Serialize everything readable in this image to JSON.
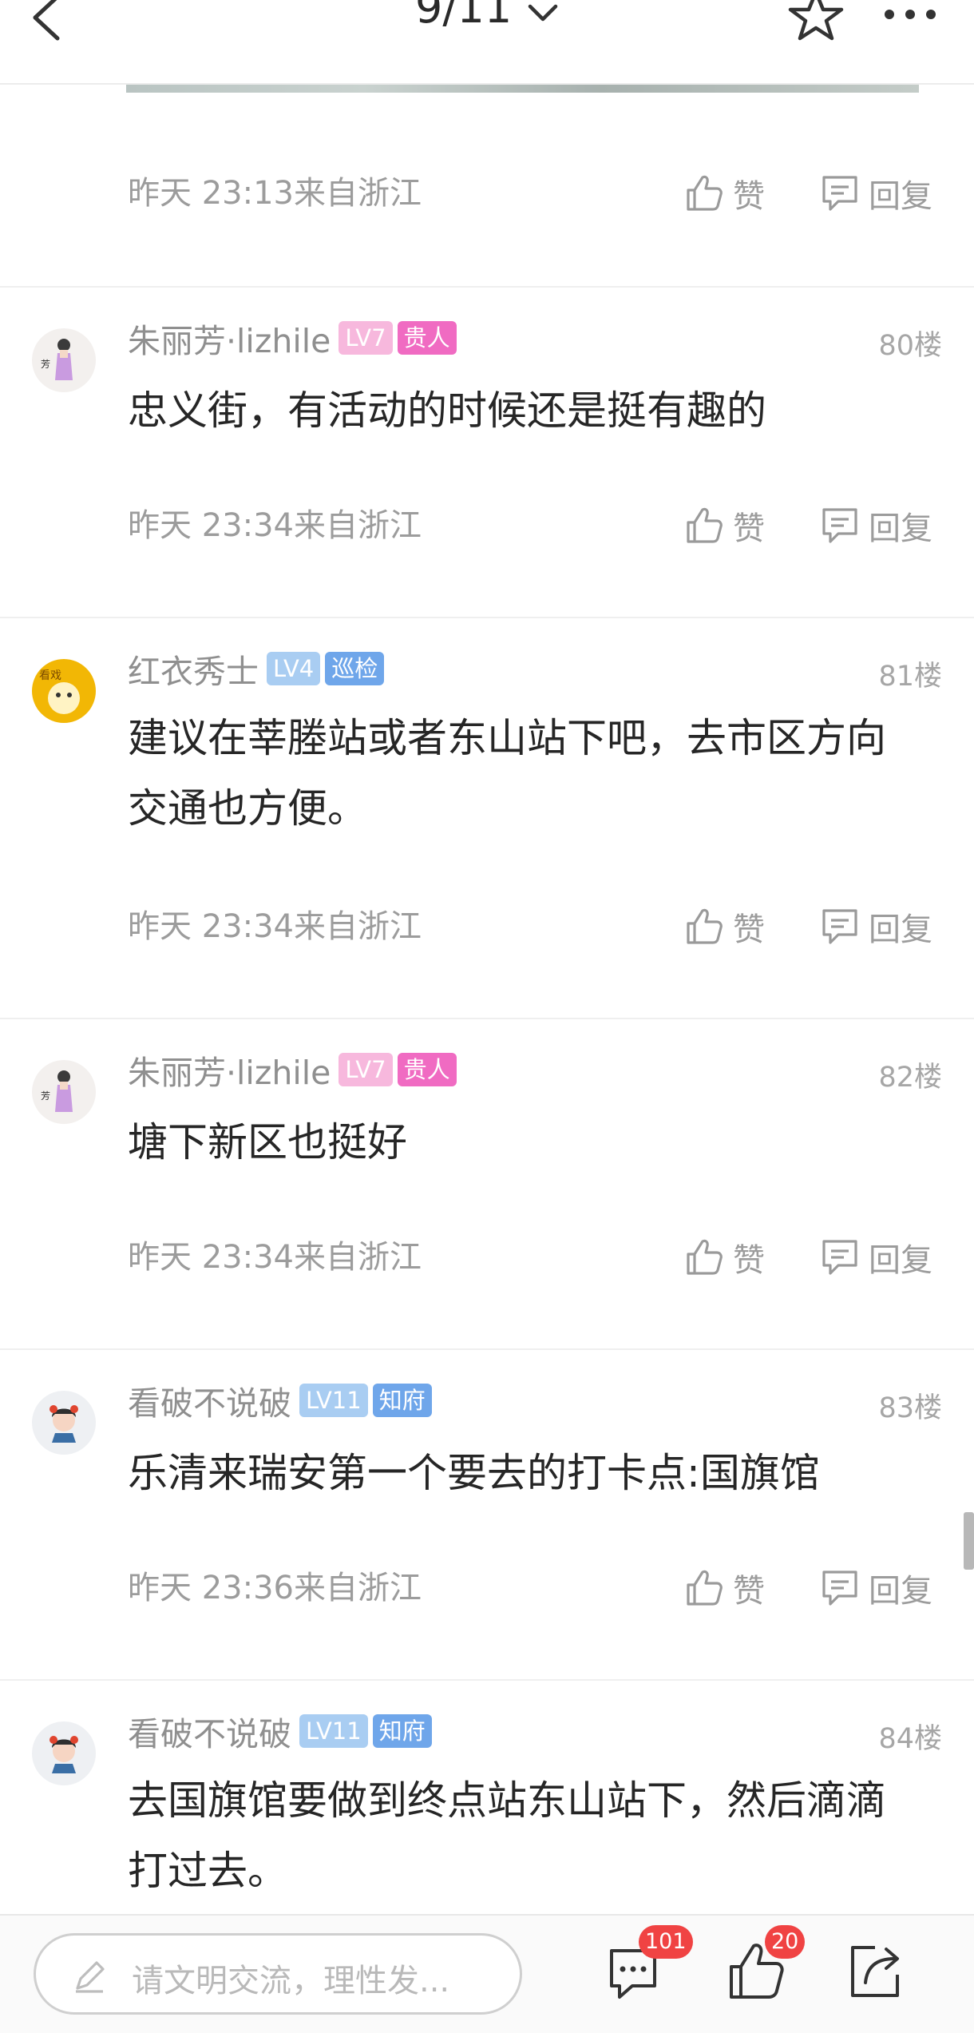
{
  "header": {
    "page_indicator": "9/11",
    "back_icon": "chevron-left-icon",
    "dropdown_icon": "chevron-down-icon",
    "favorite_icon": "star-outline-icon",
    "more_icon": "more-dots-icon"
  },
  "top_post_meta": {
    "time": "昨天 23:13来自浙江",
    "like_label": "赞",
    "reply_label": "回复"
  },
  "posts": [
    {
      "username": "朱丽芳·lizhile",
      "level": "LV7",
      "title_badge": "贵人",
      "floor": "80楼",
      "content": "忠义街，有活动的时候还是挺有趣的",
      "time": "昨天 23:34来自浙江",
      "like_label": "赞",
      "reply_label": "回复"
    },
    {
      "username": "红衣秀士",
      "level": "LV4",
      "title_badge": "巡检",
      "floor": "81楼",
      "content": "建议在莘塍站或者东山站下吧，去市区方向交通也方便。",
      "time": "昨天 23:34来自浙江",
      "like_label": "赞",
      "reply_label": "回复"
    },
    {
      "username": "朱丽芳·lizhile",
      "level": "LV7",
      "title_badge": "贵人",
      "floor": "82楼",
      "content": "塘下新区也挺好",
      "time": "昨天 23:34来自浙江",
      "like_label": "赞",
      "reply_label": "回复"
    },
    {
      "username": "看破不说破",
      "level": "LV11",
      "title_badge": "知府",
      "floor": "83楼",
      "content": "乐清来瑞安第一个要去的打卡点:国旗馆",
      "time": "昨天 23:36来自浙江",
      "like_label": "赞",
      "reply_label": "回复"
    },
    {
      "username": "看破不说破",
      "level": "LV11",
      "title_badge": "知府",
      "floor": "84楼",
      "content": "去国旗馆要做到终点站东山站下，然后滴滴打过去。"
    }
  ],
  "bottom_bar": {
    "input_placeholder": "请文明交流，理性发...",
    "comment_count": "101",
    "like_count": "20"
  },
  "colors": {
    "lv7_badge": "#f7b8dd",
    "guiren_badge": "#f06bc2",
    "lv4_badge": "#a9cdf2",
    "xunjian_badge": "#6fa6ea",
    "lv11_badge": "#a9cdf2",
    "zhifu_badge": "#6fa6ea",
    "count_badge": "#f04343"
  }
}
